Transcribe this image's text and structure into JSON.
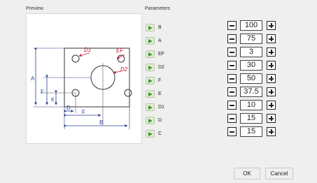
{
  "preview_label": "Preview",
  "parameters_label": "Parameters",
  "drawing": {
    "dims": [
      "D1",
      "EF",
      "D2",
      "A",
      "F",
      "E",
      "D",
      "F",
      "B"
    ]
  },
  "parameters": [
    {
      "name": "B",
      "value": "100"
    },
    {
      "name": "A",
      "value": "75"
    },
    {
      "name": "EF",
      "value": "3"
    },
    {
      "name": "D2",
      "value": "30"
    },
    {
      "name": "F",
      "value": "50"
    },
    {
      "name": "E",
      "value": "37.5"
    },
    {
      "name": "D1",
      "value": "10"
    },
    {
      "name": "D",
      "value": "15"
    },
    {
      "name": "C",
      "value": "15"
    }
  ],
  "buttons": {
    "ok": "OK",
    "cancel": "Cancel"
  },
  "colors": {
    "dimension_blue": "#2b3f8f",
    "dimension_red": "#c8102e",
    "arrow_green": "#3c9a2c"
  }
}
